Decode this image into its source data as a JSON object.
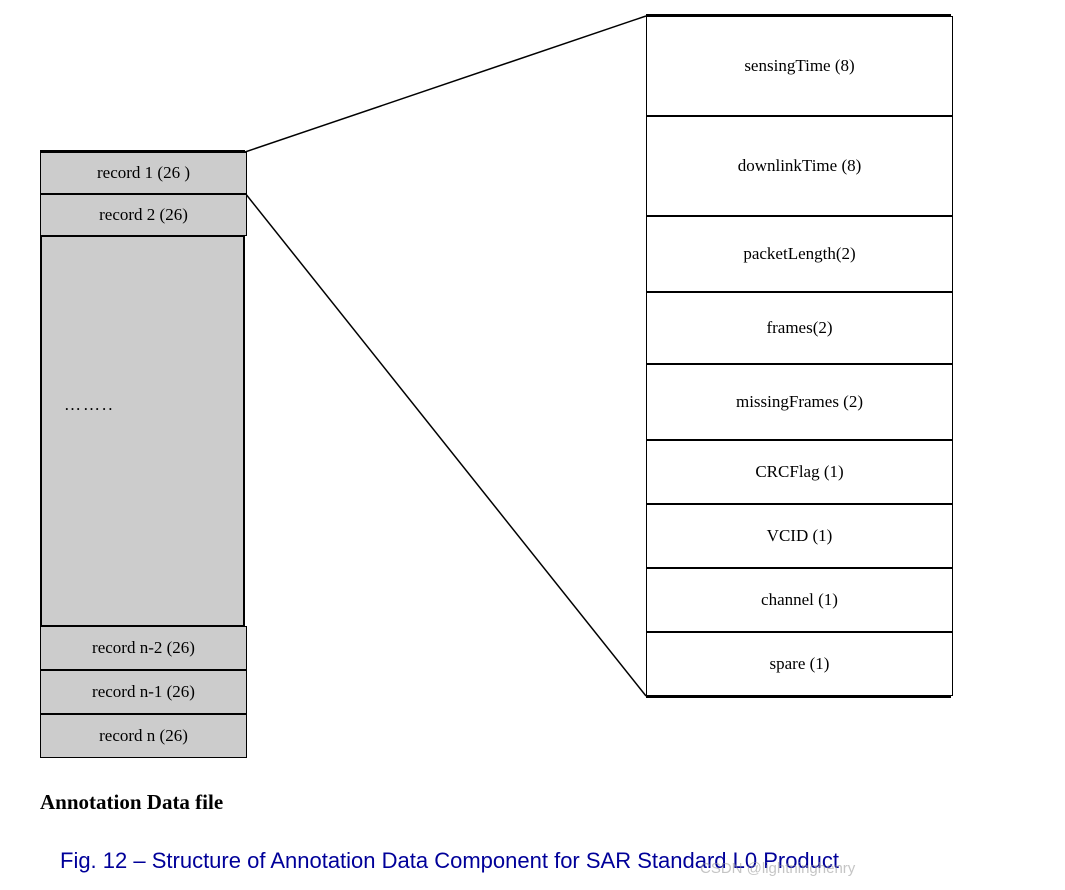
{
  "leftBox": {
    "records": [
      {
        "label": "record 1 (26 )"
      },
      {
        "label": "record 2 (26)"
      },
      {
        "label": "record n-2 (26)"
      },
      {
        "label": "record n-1 (26)"
      },
      {
        "label": "record n (26)"
      }
    ],
    "ellipsis": "……..",
    "title": "Annotation Data file"
  },
  "rightBox": {
    "fields": [
      {
        "label": "sensingTime (8)"
      },
      {
        "label": "downlinkTime (8)"
      },
      {
        "label": "packetLength(2)"
      },
      {
        "label": "frames(2)"
      },
      {
        "label": "missingFrames (2)"
      },
      {
        "label": "CRCFlag (1)"
      },
      {
        "label": "VCID (1)"
      },
      {
        "label": "channel (1)"
      },
      {
        "label": "spare (1)"
      }
    ]
  },
  "caption": "Fig. 12 – Structure of Annotation Data Component for SAR Standard L0 Product",
  "watermark": "CSDN @lightninghenry"
}
